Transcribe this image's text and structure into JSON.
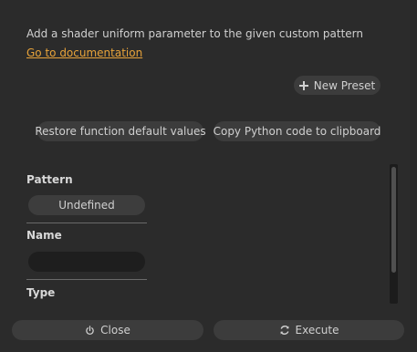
{
  "dialog": {
    "description": "Add a shader uniform parameter to the given custom pattern",
    "doc_link": "Go to documentation"
  },
  "presets": {
    "new_preset_label": "New Preset",
    "new_preset_icon": "plus-icon"
  },
  "actions": {
    "restore_label": "Restore function default values",
    "copy_label": "Copy Python code to clipboard"
  },
  "form": {
    "pattern": {
      "label": "Pattern",
      "value": "Undefined"
    },
    "name": {
      "label": "Name",
      "value": ""
    },
    "type": {
      "label": "Type"
    }
  },
  "footer": {
    "close_label": "Close",
    "close_icon": "power-icon",
    "execute_label": "Execute",
    "execute_icon": "refresh-icon"
  },
  "colors": {
    "background": "#2b2b2b",
    "button": "#3c3c3c",
    "link": "#e8a33a",
    "input": "#1e1e1e"
  }
}
